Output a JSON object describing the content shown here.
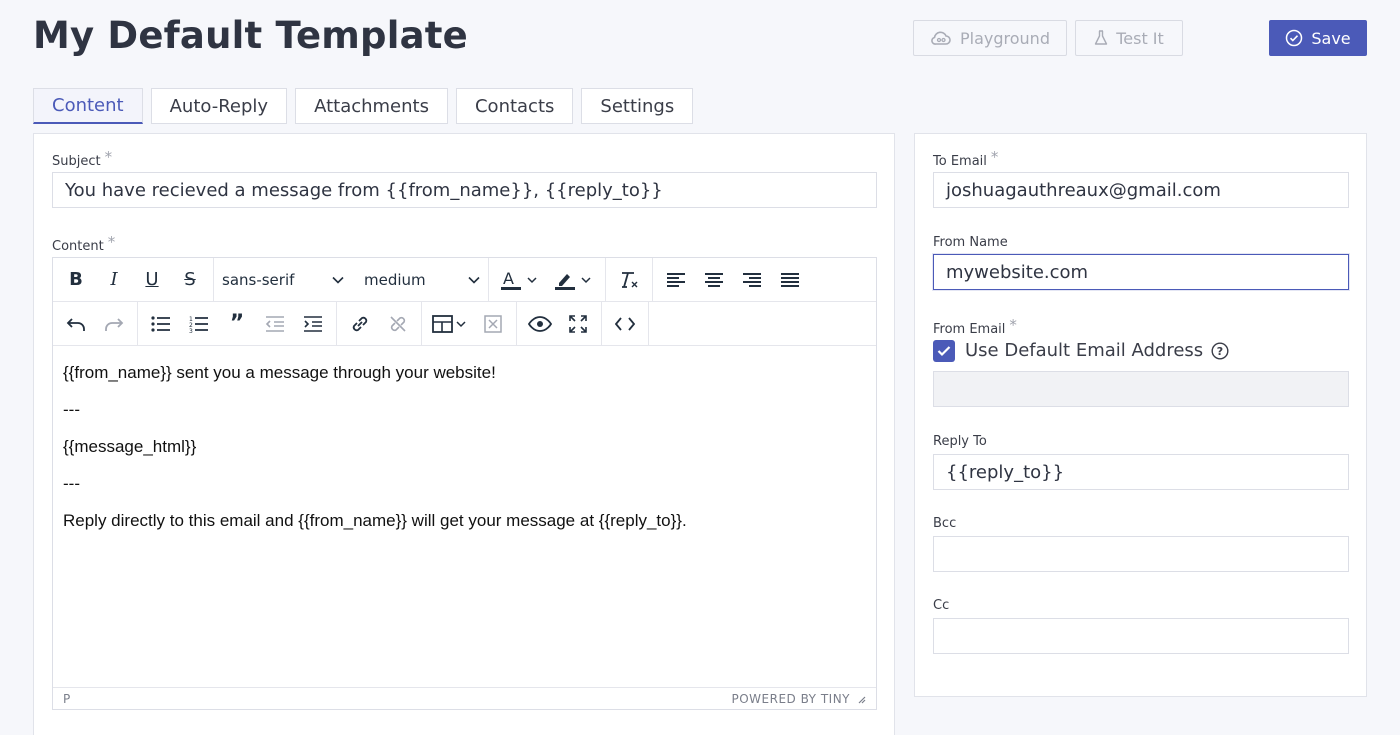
{
  "header": {
    "title": "My Default Template",
    "playground_label": "Playground",
    "testit_label": "Test It",
    "save_label": "Save"
  },
  "tabs": [
    {
      "label": "Content",
      "active": true
    },
    {
      "label": "Auto-Reply",
      "active": false
    },
    {
      "label": "Attachments",
      "active": false
    },
    {
      "label": "Contacts",
      "active": false
    },
    {
      "label": "Settings",
      "active": false
    }
  ],
  "content_panel": {
    "subject_label": "Subject",
    "subject_required": "*",
    "subject_value": "You have recieved a message from {{from_name}}, {{reply_to}}",
    "content_label": "Content",
    "content_required": "*",
    "toolbar": {
      "font_family": "sans-serif",
      "font_size": "medium"
    },
    "body_lines": [
      "{{from_name}} sent you a message through your website!",
      "---",
      "{{message_html}}",
      "---",
      "Reply directly to this email and {{from_name}} will get your message at {{reply_to}}."
    ],
    "status_path": "P",
    "powered_by": "POWERED BY TINY"
  },
  "settings_panel": {
    "to_email_label": "To Email",
    "to_email_required": "*",
    "to_email_value": "joshuagauthreaux@gmail.com",
    "from_name_label": "From Name",
    "from_name_value": "mywebsite.com",
    "from_email_label": "From Email",
    "from_email_required": "*",
    "use_default_label": "Use Default Email Address",
    "use_default_checked": true,
    "from_email_value": "",
    "reply_to_label": "Reply To",
    "reply_to_value": "{{reply_to}}",
    "bcc_label": "Bcc",
    "bcc_value": "",
    "cc_label": "Cc",
    "cc_value": ""
  },
  "colors": {
    "accent": "#4b5ab8",
    "background": "#f6f7fb",
    "title": "#2f3442"
  }
}
